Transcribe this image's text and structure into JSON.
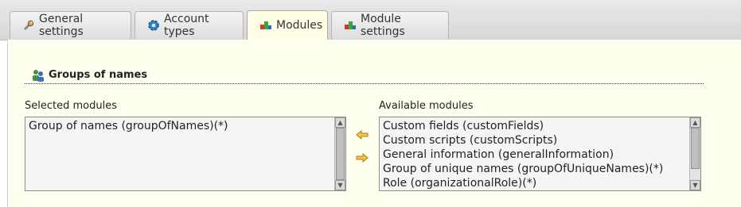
{
  "tabs": [
    {
      "label": "General settings",
      "icon": "wrench-icon"
    },
    {
      "label": "Account types",
      "icon": "gear-icon"
    },
    {
      "label": "Modules",
      "icon": "modules-icon",
      "active": true
    },
    {
      "label": "Module settings",
      "icon": "modules-icon"
    }
  ],
  "group": {
    "title": "Groups of names",
    "icon": "group-users-icon"
  },
  "selected": {
    "label": "Selected modules",
    "items": [
      "Group of names (groupOfNames)(*)"
    ]
  },
  "available": {
    "label": "Available modules",
    "items": [
      "Custom fields (customFields)",
      "Custom scripts (customScripts)",
      "General information (generalInformation)",
      "Group of unique names (groupOfUniqueNames)(*)",
      "Role (organizationalRole)(*)"
    ]
  },
  "actions": {
    "add": "add-module-arrow",
    "remove": "remove-module-arrow"
  },
  "colors": {
    "panel_bg": "#fffff0",
    "arrow": "#e8a317"
  }
}
